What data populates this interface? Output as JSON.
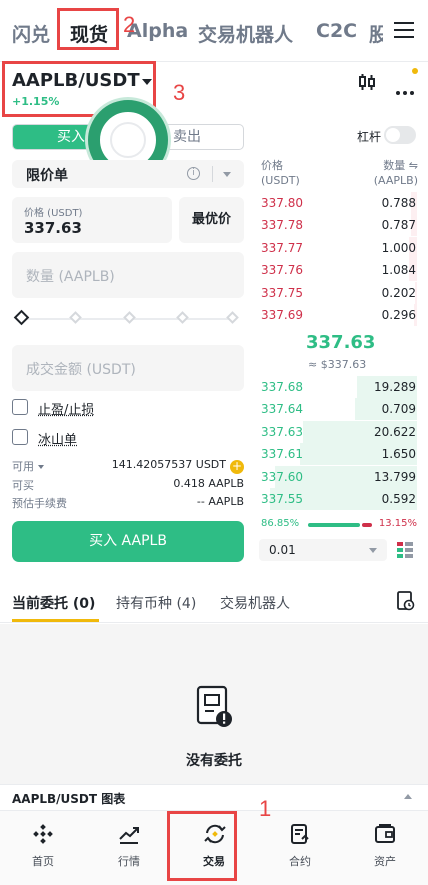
{
  "top_tabs": [
    "闪兑",
    "现货",
    "Alpha",
    "交易机器人",
    "C2C",
    "股"
  ],
  "annotations": [
    "1",
    "2",
    "3"
  ],
  "pair": {
    "symbol": "AAPLB/USDT",
    "change": "+1.15%"
  },
  "side": {
    "buy": "买入",
    "sell": "卖出"
  },
  "order_type": "限价单",
  "price": {
    "label": "价格 (USDT)",
    "value": "337.63",
    "best_label": "最优价"
  },
  "quantity_placeholder": "数量 (AAPLB)",
  "amount_placeholder": "成交金额 (USDT)",
  "checkboxes": {
    "tp_sl": "止盈/止损",
    "iceberg": "冰山单"
  },
  "balances": {
    "available_label": "可用",
    "available_value": "141.42057537 USDT",
    "can_buy_label": "可买",
    "can_buy_value": "0.418 AAPLB",
    "fee_label": "预估手续费",
    "fee_value": "-- AAPLB"
  },
  "buy_button": "买入 AAPLB",
  "leverage_label": "杠杆",
  "orderbook": {
    "price_header": "价格",
    "price_unit": "(USDT)",
    "qty_header": "数量",
    "qty_unit": "(AAPLB)",
    "asks": [
      {
        "price": "337.80",
        "qty": "0.788",
        "depth": 0.04
      },
      {
        "price": "337.78",
        "qty": "0.787",
        "depth": 0.04
      },
      {
        "price": "337.77",
        "qty": "1.000",
        "depth": 0.05
      },
      {
        "price": "337.76",
        "qty": "1.084",
        "depth": 0.05
      },
      {
        "price": "337.75",
        "qty": "0.202",
        "depth": 0.01
      },
      {
        "price": "337.69",
        "qty": "0.296",
        "depth": 0.02
      }
    ],
    "mid_price": "337.63",
    "mid_fiat": "≈ $337.63",
    "bids": [
      {
        "price": "337.68",
        "qty": "19.289",
        "depth": 0.38
      },
      {
        "price": "337.64",
        "qty": "0.709",
        "depth": 0.39
      },
      {
        "price": "337.63",
        "qty": "20.622",
        "depth": 0.72
      },
      {
        "price": "337.61",
        "qty": "1.650",
        "depth": 0.74
      },
      {
        "price": "337.60",
        "qty": "13.799",
        "depth": 0.9
      },
      {
        "price": "337.55",
        "qty": "0.592",
        "depth": 0.93
      }
    ],
    "buy_ratio": "86.85%",
    "sell_ratio": "13.15%",
    "depth_step": "0.01"
  },
  "bottom_tabs": [
    "当前委托 (0)",
    "持有币种 (4)",
    "交易机器人"
  ],
  "empty_text": "没有委托",
  "chart_bar_label": "AAPLB/USDT 图表",
  "nav": [
    "首页",
    "行情",
    "交易",
    "合约",
    "资产"
  ],
  "colors": {
    "buy": "#2ebd85",
    "sell": "#cf304a",
    "accent": "#f0b90b",
    "annotation": "#e84545"
  }
}
